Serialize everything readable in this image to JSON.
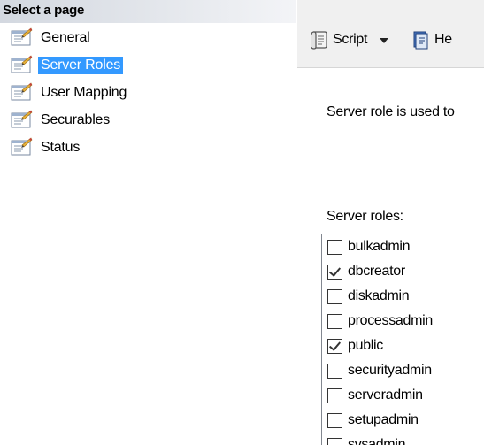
{
  "left_pane": {
    "header": "Select a page",
    "pages": [
      {
        "label": "General",
        "selected": false
      },
      {
        "label": "Server Roles",
        "selected": true
      },
      {
        "label": "User Mapping",
        "selected": false
      },
      {
        "label": "Securables",
        "selected": false
      },
      {
        "label": "Status",
        "selected": false
      }
    ]
  },
  "toolbar": {
    "script_label": "Script",
    "help_label": "He"
  },
  "main": {
    "description": "Server role is used to",
    "roles_label": "Server roles:",
    "roles": [
      {
        "name": "bulkadmin",
        "checked": false
      },
      {
        "name": "dbcreator",
        "checked": true
      },
      {
        "name": "diskadmin",
        "checked": false
      },
      {
        "name": "processadmin",
        "checked": false
      },
      {
        "name": "public",
        "checked": true
      },
      {
        "name": "securityadmin",
        "checked": false
      },
      {
        "name": "serveradmin",
        "checked": false
      },
      {
        "name": "setupadmin",
        "checked": false
      },
      {
        "name": "sysadmin",
        "checked": false
      }
    ]
  },
  "colors": {
    "selection": "#3399ff",
    "toolbar_bg": "#f0f0f0",
    "header_gradient_start": "#d3d8e0"
  },
  "icons": {
    "page": "page-properties-icon",
    "script": "script-icon",
    "help": "help-icon"
  }
}
